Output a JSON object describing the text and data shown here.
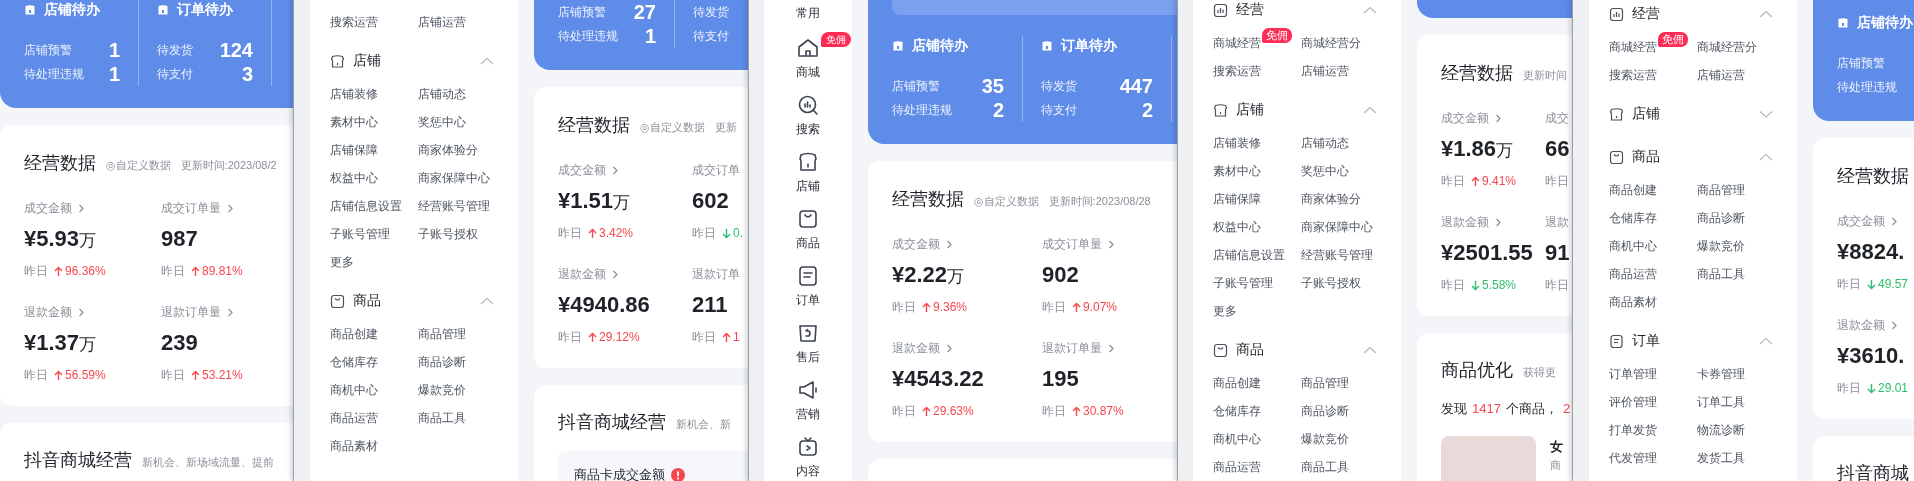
{
  "screens": [
    {
      "dashboard": {
        "todo": {
          "groups": [
            {
              "title": "店铺待办",
              "rows": [
                {
                  "label": "店铺预警",
                  "value": "1"
                },
                {
                  "label": "待处理违规",
                  "value": "1"
                }
              ]
            },
            {
              "title": "订单待办",
              "rows": [
                {
                  "label": "待发货",
                  "value": "124"
                },
                {
                  "label": "待支付",
                  "value": "3"
                }
              ]
            }
          ]
        },
        "stats": {
          "title": "经营数据",
          "custom": "◎自定义数据",
          "updated": "更新时间:2023/08/2",
          "metric_rows": [
            [
              {
                "label": "成交金额",
                "link": true,
                "value": "¥5.93",
                "unit": "万",
                "compare": "昨日",
                "change": "96.36%",
                "rising": true
              },
              {
                "label": "成交订单量",
                "link": true,
                "value": "987",
                "compare": "昨日",
                "change": "89.81%",
                "rising": true
              }
            ],
            [
              {
                "label": "退款金额",
                "link": true,
                "value": "¥1.37",
                "unit": "万",
                "compare": "昨日",
                "change": "56.59%",
                "rising": true
              },
              {
                "label": "退款订单量",
                "link": true,
                "value": "239",
                "compare": "昨日",
                "change": "53.21%",
                "rising": true
              }
            ]
          ]
        },
        "section": {
          "title": "抖音商城经营",
          "subtitle": "新机会、新场域流量、提前"
        }
      }
    },
    {
      "menu": {
        "sections": [
          {
            "items": [
              {
                "label": "搜索运营"
              },
              {
                "label": "店铺运营"
              }
            ]
          },
          {
            "kind": "store",
            "title": "店铺",
            "expanded": true,
            "items": [
              {
                "label": "店铺装修"
              },
              {
                "label": "店铺动态"
              },
              {
                "label": "素材中心"
              },
              {
                "label": "奖惩中心"
              },
              {
                "label": "店铺保障"
              },
              {
                "label": "商家体验分"
              },
              {
                "label": "权益中心"
              },
              {
                "label": "商家保障中心"
              },
              {
                "label": "店铺信息设置"
              },
              {
                "label": "经营账号管理"
              },
              {
                "label": "子账号管理"
              },
              {
                "label": "子账号授权"
              },
              {
                "label": "更多"
              }
            ]
          },
          {
            "kind": "goods",
            "title": "商品",
            "expanded": true,
            "items": [
              {
                "label": "商品创建"
              },
              {
                "label": "商品管理"
              },
              {
                "label": "仓储库存"
              },
              {
                "label": "商品诊断"
              },
              {
                "label": "商机中心"
              },
              {
                "label": "爆款竞价"
              },
              {
                "label": "商品运营"
              },
              {
                "label": "商品工具"
              },
              {
                "label": "商品素材"
              }
            ]
          }
        ]
      },
      "dashboard": {
        "todo": {
          "groups": [
            {
              "rows": [
                {
                  "label": "店铺预警",
                  "value": "27"
                },
                {
                  "label": "待处理违规",
                  "value": "1"
                }
              ]
            },
            {
              "rows": [
                {
                  "label": "待发货"
                },
                {
                  "label": "待支付"
                }
              ]
            }
          ]
        },
        "stats": {
          "title": "经营数据",
          "custom": "◎自定义数据",
          "updated": "更新",
          "metric_rows": [
            [
              {
                "label": "成交金额",
                "link": true,
                "value": "¥1.51",
                "unit": "万",
                "compare": "昨日",
                "change": "3.42%",
                "rising": true
              },
              {
                "label": "成交订单",
                "link": false,
                "value": "602",
                "compare": "昨日",
                "change": "0.",
                "rising": false
              }
            ],
            [
              {
                "label": "退款金额",
                "link": true,
                "value": "¥4940.86",
                "compare": "昨日",
                "change": "29.12%",
                "rising": true
              },
              {
                "label": "退款订单",
                "link": false,
                "value": "211",
                "compare": "昨日",
                "change": "1",
                "rising": true
              }
            ]
          ]
        },
        "section": {
          "title": "抖音商城经营",
          "subtitle": "新机会、新",
          "tile": {
            "label": "商品卡成交金额",
            "alert": true
          }
        }
      }
    },
    {
      "nav": {
        "items": [
          {
            "kind": "common",
            "label": "常用"
          },
          {
            "kind": "mall",
            "label": "商城",
            "badge": "免佣"
          },
          {
            "kind": "search",
            "label": "搜索"
          },
          {
            "kind": "store",
            "label": "店铺"
          },
          {
            "kind": "goods",
            "label": "商品"
          },
          {
            "kind": "order",
            "label": "订单"
          },
          {
            "kind": "aftersale",
            "label": "售后"
          },
          {
            "kind": "marketing",
            "label": "营销"
          },
          {
            "kind": "content",
            "label": "内容"
          }
        ]
      },
      "dashboard": {
        "todo": {
          "notice": true,
          "groups": [
            {
              "title": "店铺待办",
              "rows": [
                {
                  "label": "店铺预警",
                  "value": "35"
                },
                {
                  "label": "待处理违规",
                  "value": "2"
                }
              ]
            },
            {
              "title": "订单待办",
              "rows": [
                {
                  "label": "待发货",
                  "value": "447"
                },
                {
                  "label": "待支付",
                  "value": "2"
                }
              ]
            }
          ]
        },
        "stats": {
          "title": "经营数据",
          "custom": "◎自定义数据",
          "updated": "更新时间:2023/08/28",
          "metric_rows": [
            [
              {
                "label": "成交金额",
                "link": true,
                "value": "¥2.22",
                "unit": "万",
                "compare": "昨日",
                "change": "9.36%",
                "rising": true
              },
              {
                "label": "成交订单量",
                "link": true,
                "value": "902",
                "compare": "昨日",
                "change": "9.07%",
                "rising": true
              }
            ],
            [
              {
                "label": "退款金额",
                "link": true,
                "value": "¥4543.22",
                "compare": "昨日",
                "change": "29.63%",
                "rising": true
              },
              {
                "label": "退款订单量",
                "link": true,
                "value": "195",
                "compare": "昨日",
                "change": "30.87%",
                "rising": true
              }
            ]
          ]
        }
      }
    },
    {
      "menu": {
        "sections": [
          {
            "kind": "business",
            "title": "经营",
            "expanded": true,
            "items": [
              {
                "label": "商城经营",
                "badge": "免佣"
              },
              {
                "label": "商城经营分"
              },
              {
                "label": "搜索运营"
              },
              {
                "label": "店铺运营"
              }
            ]
          },
          {
            "kind": "store",
            "title": "店铺",
            "expanded": true,
            "items": [
              {
                "label": "店铺装修"
              },
              {
                "label": "店铺动态"
              },
              {
                "label": "素材中心"
              },
              {
                "label": "奖惩中心"
              },
              {
                "label": "店铺保障"
              },
              {
                "label": "商家体验分"
              },
              {
                "label": "权益中心"
              },
              {
                "label": "商家保障中心"
              },
              {
                "label": "店铺信息设置"
              },
              {
                "label": "经营账号管理"
              },
              {
                "label": "子账号管理"
              },
              {
                "label": "子账号授权"
              },
              {
                "label": "更多"
              }
            ]
          },
          {
            "kind": "goods",
            "title": "商品",
            "expanded": true,
            "items": [
              {
                "label": "商品创建"
              },
              {
                "label": "商品管理"
              },
              {
                "label": "仓储库存"
              },
              {
                "label": "商品诊断"
              },
              {
                "label": "商机中心"
              },
              {
                "label": "爆款竞价"
              },
              {
                "label": "商品运营"
              },
              {
                "label": "商品工具"
              }
            ]
          }
        ]
      },
      "dashboard": {
        "stats": {
          "title": "经营数据",
          "updated": "更新时间",
          "metric_rows": [
            [
              {
                "label": "成交金额",
                "link": true,
                "value": "¥1.86",
                "unit": "万",
                "compare": "昨日",
                "change": "9.41%",
                "rising": true
              },
              {
                "label": "成交",
                "link": false,
                "value": "66",
                "compare": "昨日"
              }
            ],
            [
              {
                "label": "退款金额",
                "link": true,
                "value": "¥2501.55",
                "compare": "昨日",
                "change": "5.58%",
                "rising": false
              },
              {
                "label": "退款",
                "link": false,
                "value": "91",
                "compare": "昨日"
              }
            ]
          ]
        },
        "section": {
          "title": "商品优化",
          "subtitle": "获得更",
          "summary": [
            {
              "text": "发现",
              "highlight": false
            },
            {
              "text": "1417",
              "highlight": true
            },
            {
              "text": "个商品，",
              "highlight": false
            },
            {
              "text": "2",
              "highlight": true
            }
          ],
          "product": {
            "name": "女",
            "detail": "商"
          }
        }
      }
    },
    {
      "menu": {
        "sections": [
          {
            "kind": "business",
            "title": "经营",
            "expanded": true,
            "items": [
              {
                "label": "商城经营",
                "badge": "免佣"
              },
              {
                "label": "商城经营分"
              },
              {
                "label": "搜索运营"
              },
              {
                "label": "店铺运营"
              }
            ]
          },
          {
            "kind": "store",
            "title": "店铺",
            "expanded": false
          },
          {
            "kind": "goods",
            "title": "商品",
            "expanded": true,
            "items": [
              {
                "label": "商品创建"
              },
              {
                "label": "商品管理"
              },
              {
                "label": "仓储库存"
              },
              {
                "label": "商品诊断"
              },
              {
                "label": "商机中心"
              },
              {
                "label": "爆款竞价"
              },
              {
                "label": "商品运营"
              },
              {
                "label": "商品工具"
              },
              {
                "label": "商品素材"
              }
            ]
          },
          {
            "kind": "order",
            "title": "订单",
            "expanded": true,
            "items": [
              {
                "label": "订单管理"
              },
              {
                "label": "卡券管理"
              },
              {
                "label": "评价管理"
              },
              {
                "label": "订单工具"
              },
              {
                "label": "打单发货"
              },
              {
                "label": "物流诊断"
              },
              {
                "label": "代发管理"
              },
              {
                "label": "发货工具"
              }
            ]
          }
        ]
      },
      "dashboard": {
        "todo": {
          "groups": [
            {
              "title": "店铺待办",
              "rows": [
                {
                  "label": "店铺预警"
                },
                {
                  "label": "待处理违规"
                }
              ]
            }
          ]
        },
        "stats": {
          "title": "经营数据",
          "metric_rows": [
            [
              {
                "label": "成交金额",
                "link": true,
                "value": "¥8824.",
                "compare": "昨日",
                "change": "49.57",
                "rising": false
              }
            ],
            [
              {
                "label": "退款金额",
                "link": true,
                "value": "¥3610.",
                "compare": "昨日",
                "change": "29.01",
                "rising": false
              }
            ]
          ]
        },
        "section": {
          "title": "抖音商城"
        }
      }
    }
  ]
}
